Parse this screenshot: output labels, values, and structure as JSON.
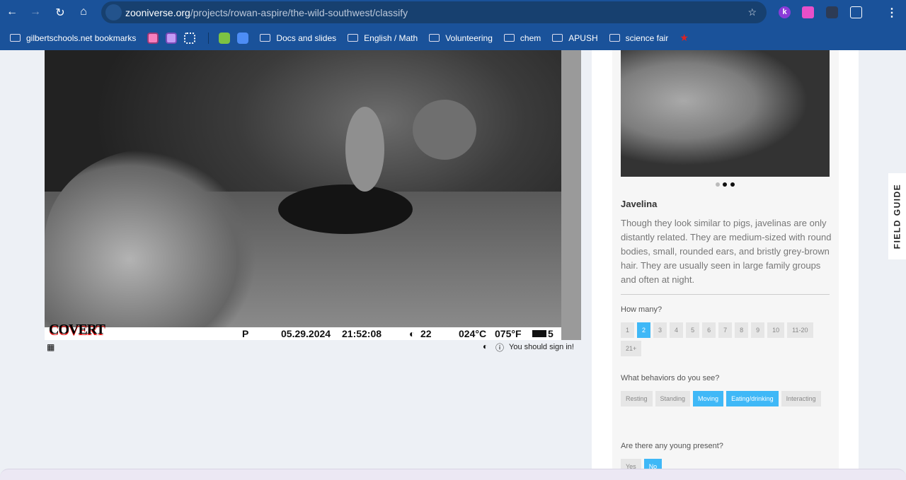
{
  "browser": {
    "url_domain": "zooniverse.org",
    "url_path": "/projects/rowan-aspire/the-wild-southwest/classify",
    "bookmarks": [
      {
        "label": "gilbertschools.net bookmarks",
        "icon": "managed-folder-icon"
      },
      {
        "label": "Docs and slides",
        "icon": "folder-icon"
      },
      {
        "label": "English / Math",
        "icon": "folder-icon"
      },
      {
        "label": "Volunteering",
        "icon": "folder-icon"
      },
      {
        "label": "chem",
        "icon": "folder-icon"
      },
      {
        "label": "APUSH",
        "icon": "folder-icon"
      },
      {
        "label": "science fair",
        "icon": "folder-icon"
      }
    ],
    "extension_k": "k"
  },
  "camera": {
    "brand": "COVERT",
    "mode": "P",
    "date": "05.29.2024",
    "time": "21:52:08",
    "moon": "22",
    "temp_c": "024°C",
    "temp_f": "075°F",
    "battery": "5"
  },
  "viewer": {
    "sign_in": "You should sign in!"
  },
  "field_guide": {
    "tab_label": "FIELD GUIDE",
    "title": "Javelina",
    "description": "Though they look similar to pigs, javelinas are only distantly related. They are medium-sized with round bodies, small, rounded ears, and bristly grey-brown hair. They are usually seen in large family groups and often at night.",
    "active_dot": 1
  },
  "questions": [
    {
      "label": "How many?",
      "options": [
        "1",
        "2",
        "3",
        "4",
        "5",
        "6",
        "7",
        "8",
        "9",
        "10",
        "11-20",
        "21+"
      ],
      "selected": [
        "2"
      ]
    },
    {
      "label": "What behaviors do you see?",
      "options": [
        "Resting",
        "Standing",
        "Moving",
        "Eating/drinking",
        "Interacting"
      ],
      "selected": [
        "Moving",
        "Eating/drinking"
      ]
    },
    {
      "label": "Are there any young present?",
      "options": [
        "Yes",
        "No"
      ],
      "selected": [
        "No"
      ]
    }
  ],
  "colors": {
    "accent": "#3fb8f7",
    "chrome": "#1a529a"
  }
}
